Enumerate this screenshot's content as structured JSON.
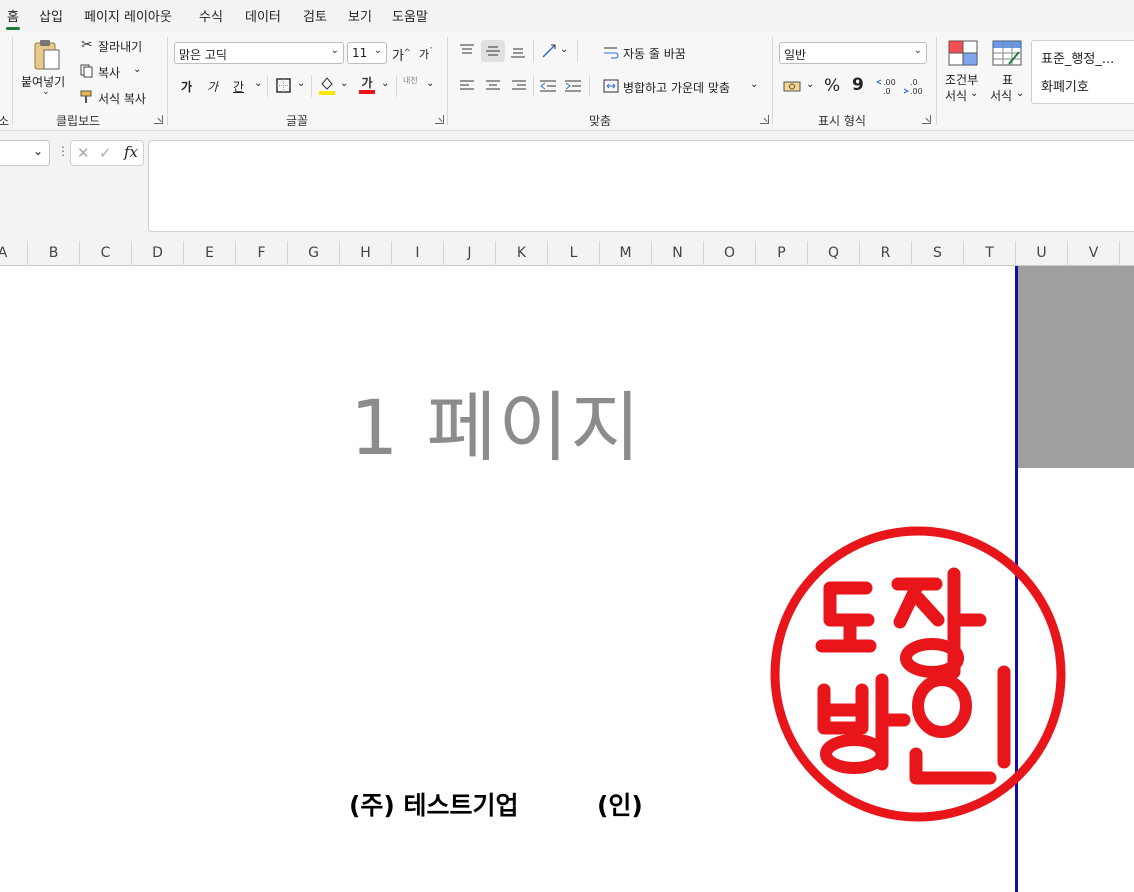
{
  "menu": {
    "tabs": [
      "홈",
      "삽입",
      "페이지 레이아웃",
      "수식",
      "데이터",
      "검토",
      "보기",
      "도움말"
    ],
    "active": "홈"
  },
  "ribbon": {
    "clipboard": {
      "paste": "붙여넣기",
      "cut": "잘라내기",
      "copy": "복사",
      "format_painter": "서식 복사",
      "label": "클립보드",
      "prev_label_fragment": "소"
    },
    "font": {
      "name": "맑은 고딕",
      "size": "11",
      "grow": "가",
      "shrink": "가",
      "bold": "가",
      "italic": "가",
      "underline": "간",
      "color_glyph": "가",
      "phonetic": "내천",
      "label": "글꼴"
    },
    "alignment": {
      "wrap_text": "자동 줄 바꿈",
      "merge_center": "병합하고 가운데 맞춤",
      "label": "맞춤"
    },
    "number": {
      "format": "일반",
      "percent": "%",
      "comma": "9",
      "label": "표시 형식"
    },
    "styles": {
      "conditional_line1": "조건부",
      "conditional_line2": "서식",
      "table_line1": "표",
      "table_line2": "서식",
      "style1": "표준_행정_...",
      "style2": "화폐기호"
    }
  },
  "formula_bar": {
    "fx": "fx"
  },
  "columns": [
    "A",
    "B",
    "C",
    "D",
    "E",
    "F",
    "G",
    "H",
    "I",
    "J",
    "K",
    "L",
    "M",
    "N",
    "O",
    "P",
    "Q",
    "R",
    "S",
    "T",
    "U",
    "V"
  ],
  "page": {
    "watermark": "1 페이지",
    "company": "(주) 테스트기업",
    "seal_mark": "(인)"
  },
  "seal": {
    "color": "#e8161b",
    "text": "도장"
  }
}
